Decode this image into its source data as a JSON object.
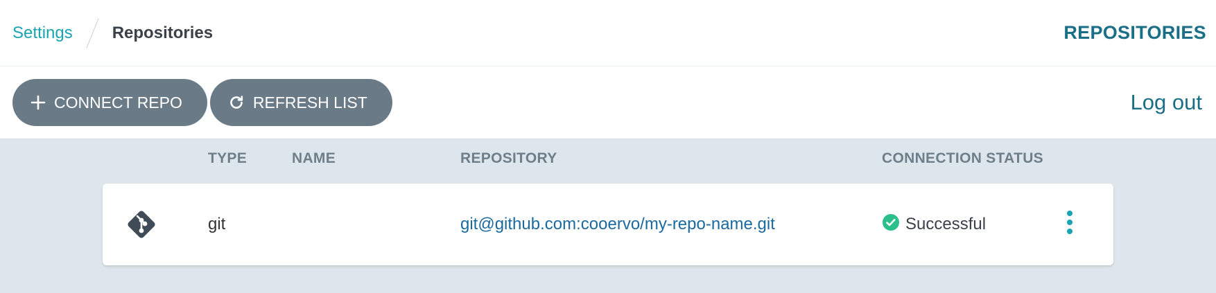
{
  "breadcrumb": {
    "parent": "Settings",
    "current": "Repositories"
  },
  "header": {
    "title": "REPOSITORIES"
  },
  "toolbar": {
    "connect_label": "CONNECT REPO",
    "refresh_label": "REFRESH LIST",
    "logout_label": "Log out"
  },
  "table": {
    "columns": [
      "TYPE",
      "NAME",
      "REPOSITORY",
      "CONNECTION STATUS"
    ],
    "rows": [
      {
        "icon": "git-icon",
        "type": "git",
        "name": "",
        "repository": "git@github.com:cooervo/my-repo-name.git",
        "status": "Successful",
        "status_icon": "check-circle-icon"
      }
    ]
  },
  "colors": {
    "accent": "#1aa3b2",
    "heading": "#1a6f86",
    "button": "#6a7b87",
    "success": "#2bbf8a",
    "table_bg": "#dde6ec"
  }
}
